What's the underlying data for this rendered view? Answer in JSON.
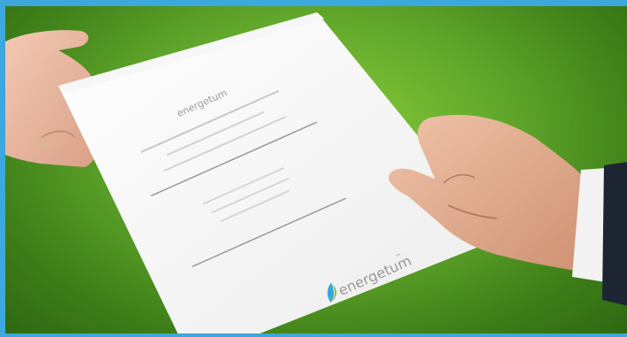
{
  "photo": {
    "frame_color": "#3ea7dc",
    "background_color": "#5fa52a",
    "document": {
      "brand_name": "energetum",
      "logo_text": "energetum",
      "logo_trademark": "™"
    }
  }
}
